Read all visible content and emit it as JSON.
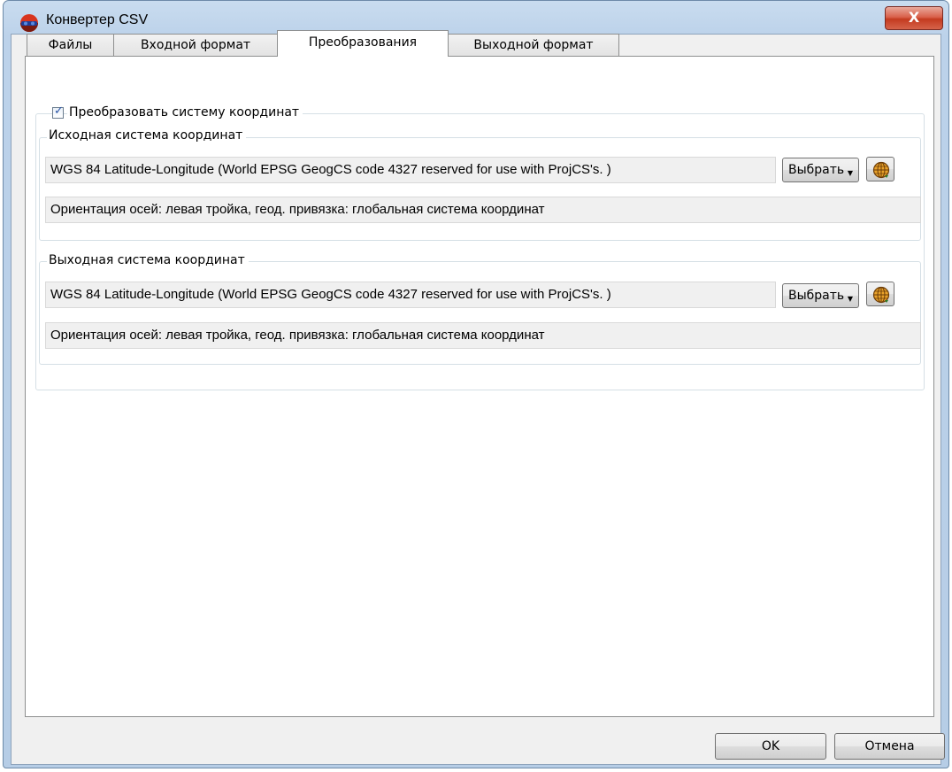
{
  "window": {
    "title": "Конвертер CSV",
    "close_glyph": "X"
  },
  "tabs": [
    {
      "label": "Файлы"
    },
    {
      "label": "Входной формат"
    },
    {
      "label": "Преобразования"
    },
    {
      "label": "Выходной формат"
    }
  ],
  "active_tab": "Преобразования",
  "transform": {
    "checkbox_label": "Преобразовать систему координат",
    "checked": true,
    "source": {
      "legend": "Исходная система координат",
      "value": "WGS 84 Latitude-Longitude (World EPSG GeogCS code 4327 reserved for use with  ProjCS's. )",
      "select_label": "Выбрать",
      "info": "Ориентация осей: левая тройка, геод. привязка: глобальная система координат"
    },
    "target": {
      "legend": "Выходная система координат",
      "value": "WGS 84 Latitude-Longitude (World EPSG GeogCS code 4327 reserved for use with  ProjCS's. )",
      "select_label": "Выбрать",
      "info": "Ориентация осей: левая тройка, геод. привязка: глобальная система координат"
    }
  },
  "footer": {
    "ok_label": "OK",
    "cancel_label": "Отмена"
  },
  "icons": {
    "app": "app-icon",
    "globe": "globe-icon",
    "dropdown": "chevron-down-icon"
  },
  "colors": {
    "titlebar": "#bcd2ea",
    "close_button": "#c43b20",
    "checkbox_check": "#2a54a6",
    "globe": "#d08a1a"
  }
}
